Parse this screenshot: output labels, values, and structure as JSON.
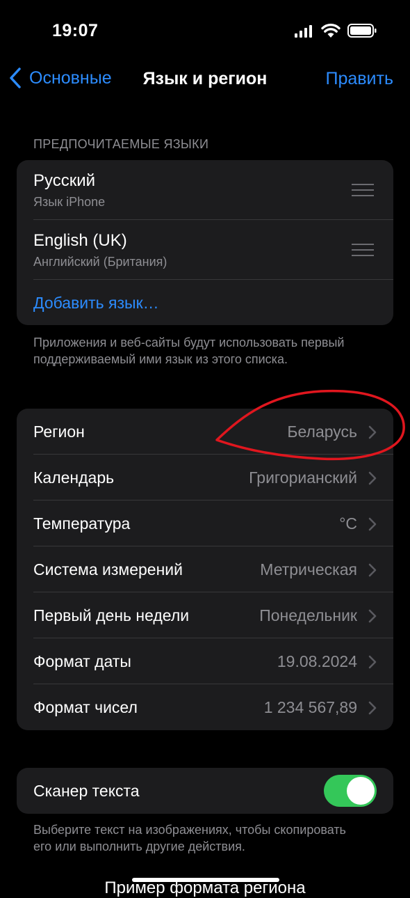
{
  "status": {
    "time": "19:07"
  },
  "nav": {
    "back_label": "Основные",
    "title": "Язык и регион",
    "edit_label": "Править"
  },
  "languages": {
    "header": "ПРЕДПОЧИТАЕМЫЕ ЯЗЫКИ",
    "items": [
      {
        "name": "Русский",
        "subtitle": "Язык iPhone"
      },
      {
        "name": "English (UK)",
        "subtitle": "Английский (Британия)"
      }
    ],
    "add_label": "Добавить язык…",
    "footer": "Приложения и веб-сайты будут использовать первый поддерживаемый ими язык из этого списка."
  },
  "region": {
    "rows": [
      {
        "label": "Регион",
        "value": "Беларусь"
      },
      {
        "label": "Календарь",
        "value": "Григорианский"
      },
      {
        "label": "Температура",
        "value": "°C"
      },
      {
        "label": "Система измерений",
        "value": "Метрическая"
      },
      {
        "label": "Первый день недели",
        "value": "Понедельник"
      },
      {
        "label": "Формат даты",
        "value": "19.08.2024"
      },
      {
        "label": "Формат чисел",
        "value": "1 234 567,89"
      }
    ]
  },
  "text_scanner": {
    "label": "Сканер текста",
    "enabled": true,
    "footer": "Выберите текст на изображениях, чтобы скопировать его или выполнить другие действия."
  },
  "region_format_preview": {
    "title": "Пример формата региона"
  },
  "colors": {
    "accent": "#2c8cff",
    "toggle_on": "#34c759",
    "annotation": "#e0161e"
  }
}
